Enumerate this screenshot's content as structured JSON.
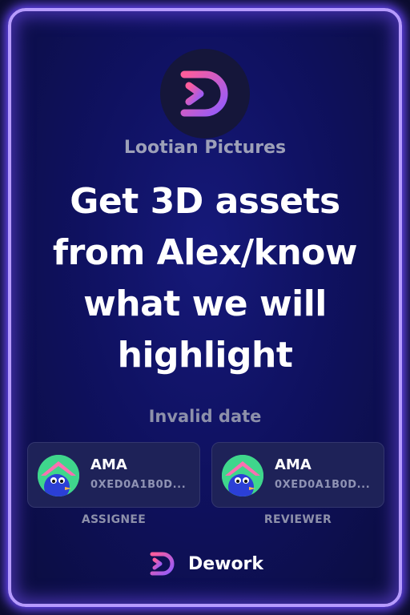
{
  "organization": {
    "name": "Lootian Pictures",
    "logo": "dework-logo-icon"
  },
  "task": {
    "title_lines": [
      "Get 3D assets",
      "from Alex/know",
      "what we will",
      "highlight"
    ],
    "date": "Invalid date"
  },
  "people": [
    {
      "name": "AMA",
      "address": "0XED0A1B0D...",
      "role": "ASSIGNEE",
      "avatar": "avatar-icon"
    },
    {
      "name": "AMA",
      "address": "0XED0A1B0D...",
      "role": "REVIEWER",
      "avatar": "avatar-icon"
    }
  ],
  "brand": {
    "name": "Dework",
    "logo": "dework-logo-icon"
  },
  "colors": {
    "card_border": "#b69bff",
    "card_background": "#0f1160",
    "logo_gradient_start": "#ff5d9b",
    "logo_gradient_end": "#8f5bff",
    "avatar_background": "#3fd68c"
  }
}
